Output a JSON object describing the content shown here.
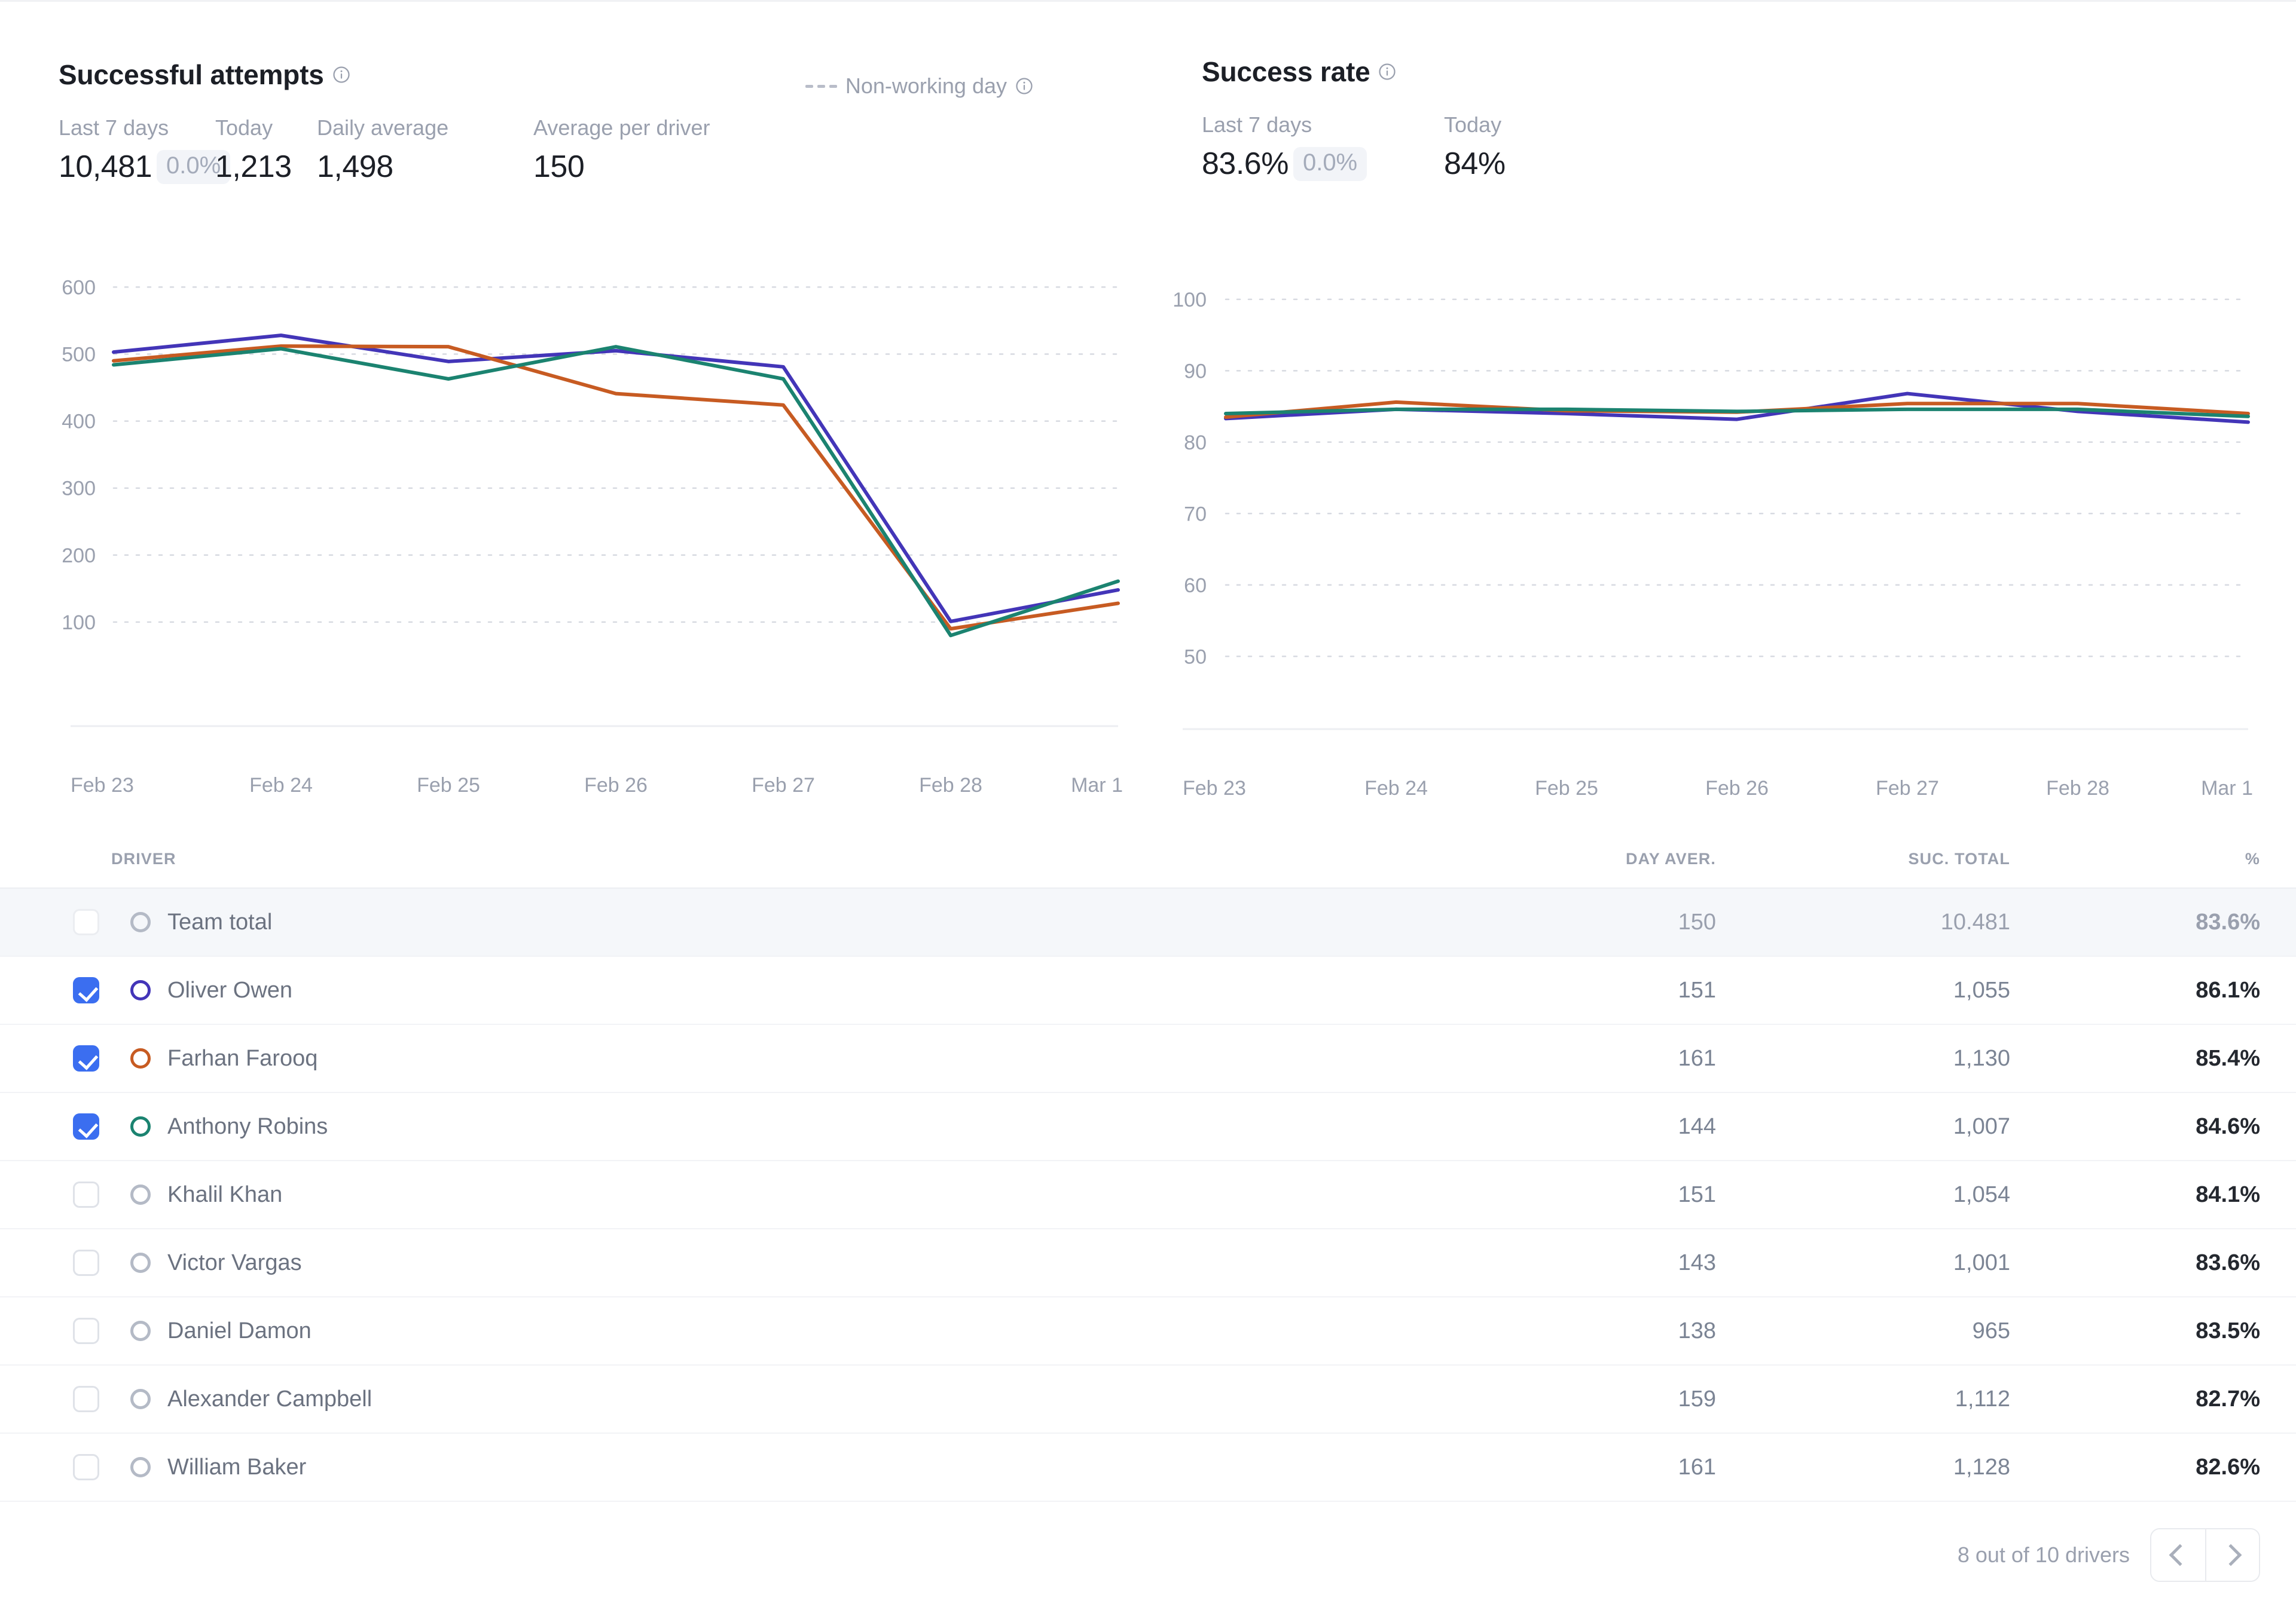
{
  "panels": {
    "attempts": {
      "title": "Successful attempts",
      "legend": {
        "label": "Non-working day"
      },
      "metrics": [
        {
          "label": "Last 7 days",
          "value": "10,481",
          "delta": "0.0%"
        },
        {
          "label": "Today",
          "value": "1,213"
        },
        {
          "label": "Daily average",
          "value": "1,498"
        },
        {
          "label": "Average per driver",
          "value": "150"
        }
      ]
    },
    "success_rate": {
      "title": "Success rate",
      "metrics": [
        {
          "label": "Last 7 days",
          "value": "83.6%",
          "delta": "0.0%"
        },
        {
          "label": "Today",
          "value": "84%"
        }
      ]
    }
  },
  "chart_data": [
    {
      "type": "line",
      "title": "Successful attempts",
      "xlabel": "",
      "ylabel": "",
      "x": [
        "Feb 23",
        "Feb 24",
        "Feb 25",
        "Feb 26",
        "Feb 27",
        "Feb 28",
        "Mar 1"
      ],
      "ylim": [
        0,
        620
      ],
      "yticks": [
        100,
        200,
        300,
        400,
        500,
        600
      ],
      "grid": true,
      "legend": "none",
      "series": [
        {
          "name": "Oliver Owen",
          "color": "#4335b8",
          "values": [
            503,
            528,
            489,
            505,
            481,
            101,
            148
          ]
        },
        {
          "name": "Farhan Farooq",
          "color": "#c75b22",
          "values": [
            490,
            512,
            511,
            441,
            424,
            90,
            128
          ]
        },
        {
          "name": "Anthony Robins",
          "color": "#1b8370",
          "values": [
            484,
            508,
            463,
            511,
            463,
            80,
            161
          ]
        }
      ]
    },
    {
      "type": "line",
      "title": "Success rate",
      "xlabel": "",
      "ylabel": "",
      "x": [
        "Feb 23",
        "Feb 24",
        "Feb 25",
        "Feb 26",
        "Feb 27",
        "Feb 28",
        "Mar 1"
      ],
      "ylim": [
        45,
        103
      ],
      "yticks": [
        50,
        60,
        70,
        80,
        90,
        100
      ],
      "grid": true,
      "legend": "none",
      "series": [
        {
          "name": "Oliver Owen",
          "color": "#4335b8",
          "values": [
            83.3,
            84.6,
            84.0,
            83.2,
            86.8,
            84.3,
            82.8
          ]
        },
        {
          "name": "Farhan Farooq",
          "color": "#c75b22",
          "values": [
            83.5,
            85.6,
            84.4,
            84.2,
            85.4,
            85.4,
            84.0
          ]
        },
        {
          "name": "Anthony Robins",
          "color": "#1b8370",
          "values": [
            84.0,
            84.6,
            84.6,
            84.3,
            84.6,
            84.6,
            83.6
          ]
        }
      ]
    }
  ],
  "table": {
    "columns": [
      "DRIVER",
      "DAY AVER.",
      "SUC. TOTAL",
      "%"
    ],
    "rows": [
      {
        "name": "Team total",
        "checked": false,
        "is_total": true,
        "marker_color": "#b4bac6",
        "day_aver": "150",
        "suc_total": "10.481",
        "pct": "83.6%"
      },
      {
        "name": "Oliver Owen",
        "checked": true,
        "is_total": false,
        "marker_color": "#4335b8",
        "day_aver": "151",
        "suc_total": "1,055",
        "pct": "86.1%"
      },
      {
        "name": "Farhan Farooq",
        "checked": true,
        "is_total": false,
        "marker_color": "#c75b22",
        "day_aver": "161",
        "suc_total": "1,130",
        "pct": "85.4%"
      },
      {
        "name": "Anthony Robins",
        "checked": true,
        "is_total": false,
        "marker_color": "#1b8370",
        "day_aver": "144",
        "suc_total": "1,007",
        "pct": "84.6%"
      },
      {
        "name": "Khalil Khan",
        "checked": false,
        "is_total": false,
        "marker_color": "#b4bac6",
        "day_aver": "151",
        "suc_total": "1,054",
        "pct": "84.1%"
      },
      {
        "name": "Victor Vargas",
        "checked": false,
        "is_total": false,
        "marker_color": "#b4bac6",
        "day_aver": "143",
        "suc_total": "1,001",
        "pct": "83.6%"
      },
      {
        "name": "Daniel Damon",
        "checked": false,
        "is_total": false,
        "marker_color": "#b4bac6",
        "day_aver": "138",
        "suc_total": "965",
        "pct": "83.5%"
      },
      {
        "name": "Alexander Campbell",
        "checked": false,
        "is_total": false,
        "marker_color": "#b4bac6",
        "day_aver": "159",
        "suc_total": "1,112",
        "pct": "82.7%"
      },
      {
        "name": "William Baker",
        "checked": false,
        "is_total": false,
        "marker_color": "#b4bac6",
        "day_aver": "161",
        "suc_total": "1,128",
        "pct": "82.6%"
      }
    ],
    "footer": {
      "count_text": "8 out of 10 drivers"
    }
  },
  "colors": {
    "series_1": "#4335b8",
    "series_2": "#c75b22",
    "series_3": "#1b8370",
    "checkbox_accent": "#3b6ef0"
  }
}
